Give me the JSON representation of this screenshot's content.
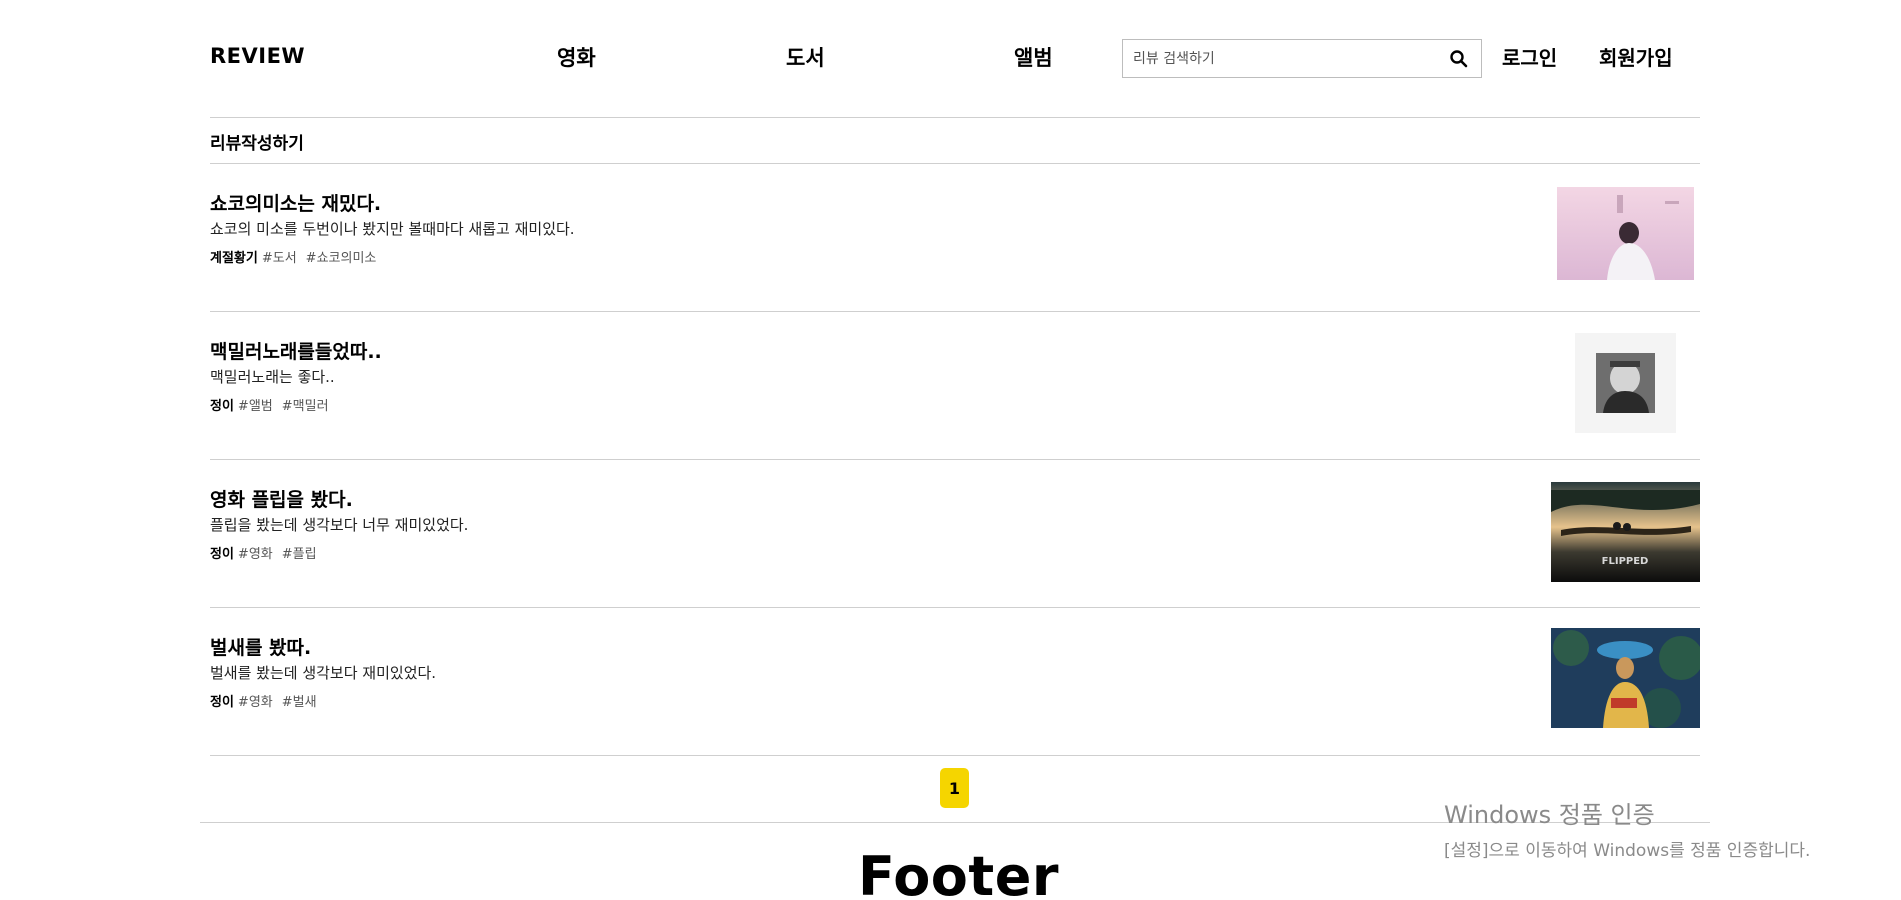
{
  "header": {
    "logo": "REVIEW",
    "nav": {
      "movie": "영화",
      "book": "도서",
      "album": "앨범"
    },
    "search": {
      "placeholder": "리뷰 검색하기",
      "value": ""
    },
    "login": "로그인",
    "signup": "회원가입"
  },
  "write_review": "리뷰작성하기",
  "reviews": [
    {
      "title": "쇼코의미소는 재밌다.",
      "body": "쇼코의 미소를 두번이나 봤지만 볼때마다 새롭고 재미있다.",
      "author": "계절황기",
      "tags": [
        "#도서",
        "#쇼코의미소"
      ]
    },
    {
      "title": "맥밀러노래를들었따..",
      "body": "맥밀러노래는 좋다..",
      "author": "정이",
      "tags": [
        "#앨범",
        "#맥밀러"
      ]
    },
    {
      "title": "영화 플립을 봤다.",
      "body": "플립을 봤는데 생각보다 너무 재미있었다.",
      "author": "정이",
      "tags": [
        "#영화",
        "#플립"
      ]
    },
    {
      "title": "벌새를 봤따.",
      "body": "벌새를 봤는데 생각보다 재미있었다.",
      "author": "정이",
      "tags": [
        "#영화",
        "#벌새"
      ]
    }
  ],
  "thumbnails": {
    "review4_poster_text": "FLIPPED"
  },
  "pagination": {
    "current": "1"
  },
  "footer": {
    "title": "Footer"
  },
  "watermark": {
    "title": "Windows 정품 인증",
    "subtitle": "[설정]으로 이동하여 Windows를 정품 인증합니다."
  },
  "colors": {
    "accent": "#f5d500",
    "divider": "#cfcfcf",
    "tag": "#555555"
  },
  "icons": {
    "search": "search-icon"
  }
}
